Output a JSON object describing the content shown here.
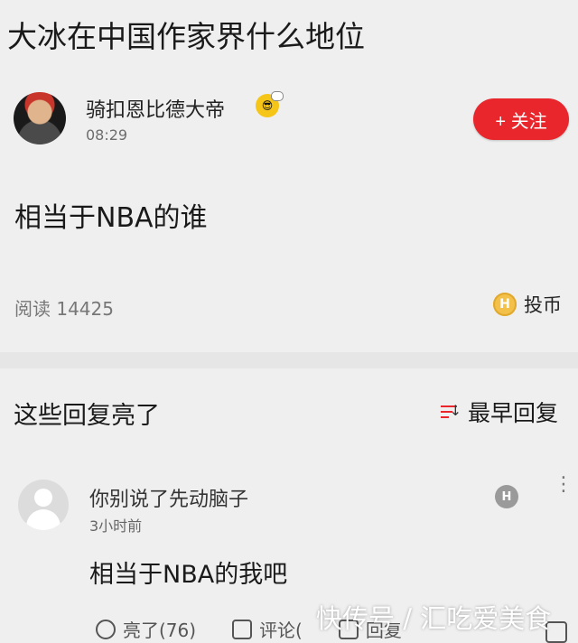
{
  "question": {
    "title": "大冰在中国作家界什么地位"
  },
  "post": {
    "author": "骑扣恩比德大帝",
    "time": "08:29",
    "follow_label": "+ 关注",
    "content": "相当于NBA的谁",
    "reads": "阅读 14425",
    "coin_label": "投币",
    "coin_letter": "H"
  },
  "replies_section": {
    "title": "这些回复亮了",
    "sort_label": "最早回复",
    "accent": "#e8262c"
  },
  "comment": {
    "author": "你别说了先动脑子",
    "time": "3小时前",
    "content": "相当于NBA的我吧",
    "coin_letter": "H",
    "more": "⋮",
    "actions": {
      "like": "亮了(76)",
      "comment": "评论(",
      "reply": "回复"
    }
  },
  "watermark": "快传号 / 汇吃爱美食",
  "icons": [
    "avatar",
    "sunglasses-emoji-icon",
    "plus-icon",
    "coin-icon",
    "sort-icon",
    "more-icon",
    "lightbulb-icon",
    "comment-icon",
    "reply-icon",
    "share-icon"
  ]
}
